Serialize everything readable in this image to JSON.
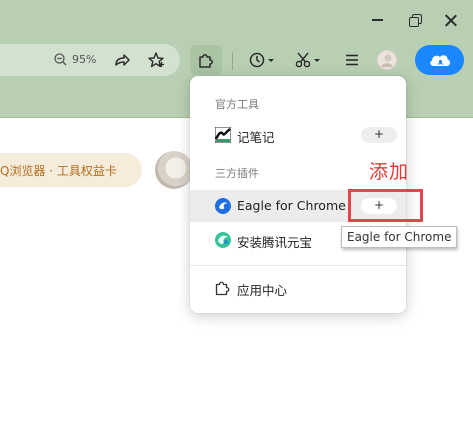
{
  "toolbar": {
    "zoom_level": "95%"
  },
  "page": {
    "promo_pill": "Q浏览器 · 工具权益卡"
  },
  "extensions_menu": {
    "official_section": "官方工具",
    "third_party_section": "三方插件",
    "items": [
      {
        "label": "记笔记",
        "action": "+"
      },
      {
        "label": "Eagle for Chrome",
        "action": "+"
      },
      {
        "label": "安装腾讯元宝"
      }
    ],
    "app_center": "应用中心"
  },
  "annotation": {
    "text": "添加",
    "color": "#e53935"
  },
  "tooltip": "Eagle for Chrome",
  "colors": {
    "chrome_bg": "#b9cfb3",
    "accent_blue": "#1a86ff",
    "promo_text": "#b56d1c"
  }
}
